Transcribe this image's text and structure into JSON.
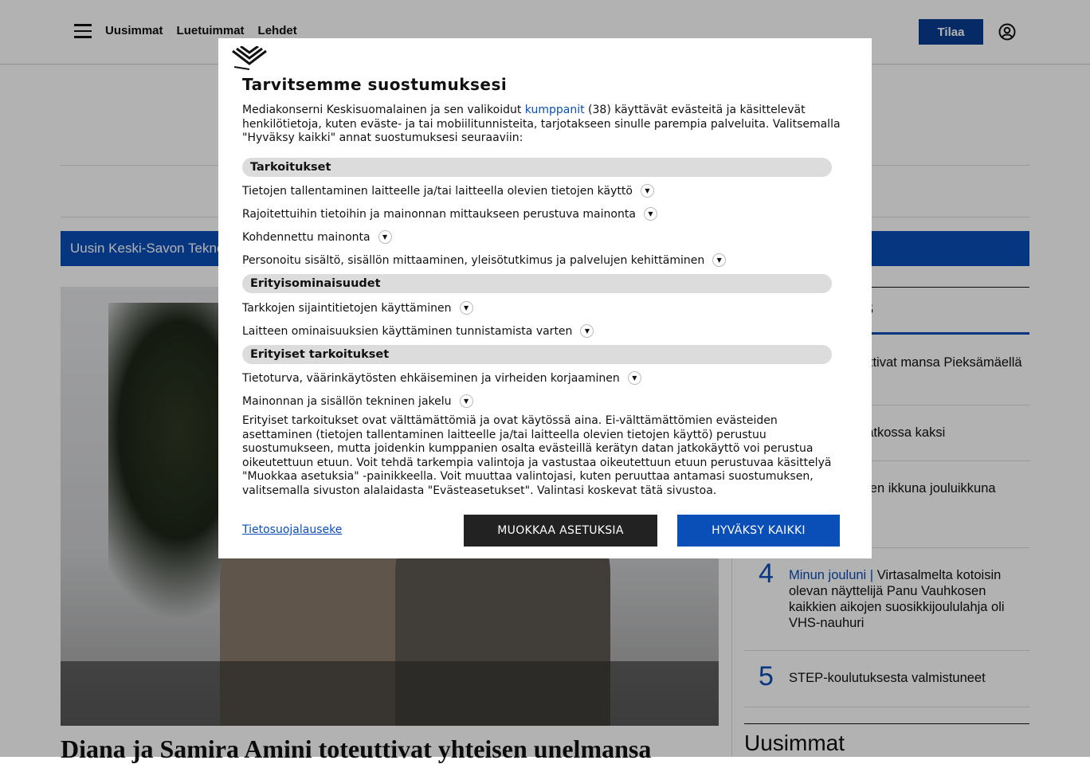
{
  "nav": {
    "items": [
      "Uusimmat",
      "Luetuimmat",
      "Lehdet"
    ],
    "subscribe": "Tilaa"
  },
  "ticker": {
    "text": "Uusin Keski-Savon Tekno"
  },
  "hero": {
    "headline": "Diana ja Samira Amini toteuttivat yhteisen unelmansa"
  },
  "sidebar": {
    "tab": "S",
    "items": [
      {
        "rank": "",
        "kicker": "",
        "text": "ra Amini toteuttivat mansa Pieksämäellä"
      },
      {
        "rank": "",
        "kicker": "",
        "text": "ajan virkaan jatkossa kaksi"
      },
      {
        "rank": "",
        "kicker": "",
        "text": "n tunnelmallinen ikkuna jouluikkuna -äänestyksen"
      },
      {
        "rank": "4",
        "kicker": "Minun jouluni |",
        "text": " Virtasalmelta kotoisin olevan näyttelijä Panu Vauhkosen kaikkien aikojen suosikkijoululahja oli VHS-nauhuri"
      },
      {
        "rank": "5",
        "kicker": "",
        "text": "STEP-koulutuksesta valmistuneet"
      }
    ],
    "latest": "Uusimmat"
  },
  "consent": {
    "title": "Tarvitsemme suostumuksesi",
    "intro_a": "Mediakonserni Keskisuomalainen ja sen valikoidut ",
    "intro_link": "kumppanit",
    "intro_b": " (38) käyttävät evästeitä ja käsittelevät henkilötietoja, kuten eväste- ja tai mobiilitunnisteita, tarjotakseen sinulle parempia palveluita. Valitsemalla \"Hyväksy kaikki\" annat suostumuksesi seuraaviin:",
    "sections": {
      "purposes": "Tarkoitukset",
      "features": "Erityisominaisuudet",
      "special": "Erityiset tarkoitukset"
    },
    "purposes": [
      "Tietojen tallentaminen laitteelle ja/tai laitteella olevien tietojen käyttö",
      "Rajoitettuihin tietoihin ja mainonnan mittaukseen perustuva mainonta",
      "Kohdennettu mainonta",
      "Personoitu sisältö, sisällön mittaaminen, yleisötutkimus ja palvelujen kehittäminen"
    ],
    "features": [
      "Tarkkojen sijaintitietojen käyttäminen",
      "Laitteen ominaisuuksien käyttäminen tunnistamista varten"
    ],
    "special": [
      "Tietoturva, väärinkäytösten ehkäiseminen ja virheiden korjaaminen",
      "Mainonnan ja sisällön tekninen jakelu"
    ],
    "note": "Erityiset tarkoitukset ovat välttämättömiä ja ovat käytössä aina. Ei-välttämättömien evästeiden asettaminen (tietojen tallentaminen laitteelle ja/tai laitteella olevien tietojen käyttö) perustuu suostumukseen, mutta joidenkin kumppanien osalta evästeillä kerätyn datan jatkokäyttö voi perustua oikeutettuun etuun. Voit tehdä tarkempia valintoja ja vastustaa oikeutettuun etuun perustuvaa käsittelyä \"Muokkaa asetuksia\" -painikkeella. Voit muuttaa valintojasi, kuten peruuttaa antamasi suostumuksen, valitsemalla sivuston alalaidasta \"Evästeasetukset\". Valintasi koskevat tätä sivustoa.",
    "privacy_link": "Tietosuojalauseke",
    "edit_button": "MUOKKAA ASETUKSIA",
    "accept_button": "HYVÄKSY KAIKKI"
  }
}
